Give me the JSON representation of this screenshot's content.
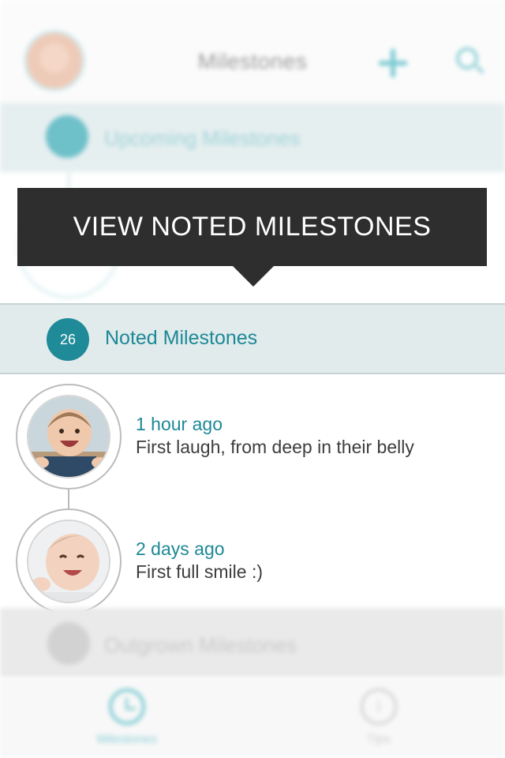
{
  "header": {
    "title": "Milestones",
    "icons": [
      "baby-avatar-icon",
      "plus-icon",
      "search-icon"
    ]
  },
  "upcoming": {
    "badge": "",
    "label": "Upcoming Milestones"
  },
  "tooltip": {
    "text": "VIEW NOTED MILESTONES"
  },
  "noted": {
    "count": "26",
    "label": "Noted Milestones"
  },
  "entries": [
    {
      "time": "1 hour ago",
      "text": "First laugh, from deep in their belly"
    },
    {
      "time": "2 days ago",
      "text": "First full smile :)"
    }
  ],
  "outgrown": {
    "label": "Outgrown Milestones"
  },
  "tabbar": {
    "items": [
      {
        "label": "Milestones",
        "icon": "clock-icon",
        "active": true
      },
      {
        "label": "Tips",
        "icon": "info-icon",
        "active": false
      }
    ]
  },
  "colors": {
    "accent": "#1f8a98",
    "tooltip_bg": "#2e2e2e"
  }
}
